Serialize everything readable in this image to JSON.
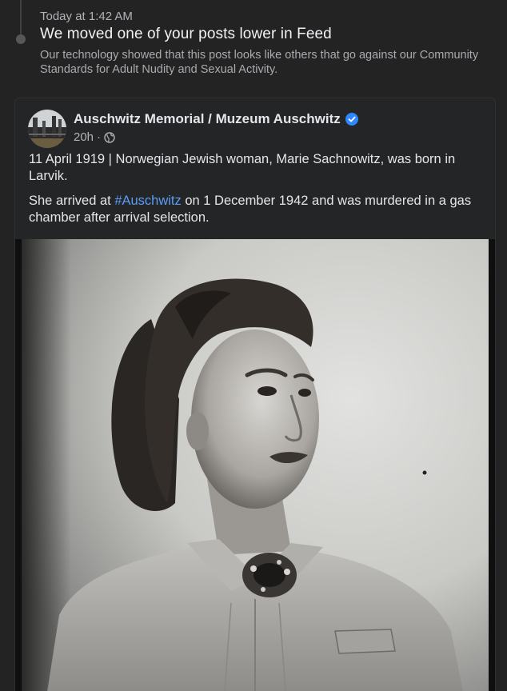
{
  "notice": {
    "time": "Today at 1:42 AM",
    "title": "We moved one of your posts lower in Feed",
    "body": "Our technology showed that this post looks like others that go against our Community Standards for Adult Nudity and Sexual Activity."
  },
  "post": {
    "author": "Auschwitz Memorial / Muzeum Auschwitz",
    "verified_icon": "verified-badge-icon",
    "age": "20h",
    "separator": "·",
    "privacy_icon": "globe-icon",
    "paragraph1": "11 April 1919 | Norwegian Jewish woman, Marie Sachnowitz, was born in Larvik.",
    "paragraph2_before": "She arrived at ",
    "paragraph2_hashtag": "#Auschwitz",
    "paragraph2_after": " on 1 December 1942 and was murdered in a gas chamber after arrival selection.",
    "photo_description_icon": "portrait-photo"
  },
  "colors": {
    "background": "#232323",
    "card": "#242526",
    "text": "#e4e6eb",
    "muted": "#b0b3b8",
    "link": "#5b9cf5",
    "verified": "#2d88ff"
  }
}
